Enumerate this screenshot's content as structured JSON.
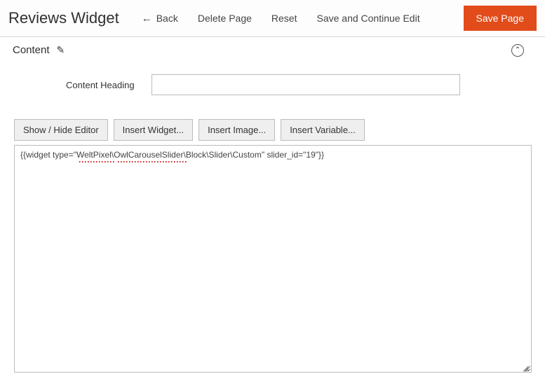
{
  "header": {
    "title": "Reviews Widget",
    "back_label": "Back",
    "delete_label": "Delete Page",
    "reset_label": "Reset",
    "save_continue_label": "Save and Continue Edit",
    "save_label": "Save Page"
  },
  "section": {
    "label": "Content"
  },
  "form": {
    "heading_label": "Content Heading",
    "heading_value": ""
  },
  "toolbar": {
    "show_hide": "Show / Hide Editor",
    "insert_widget": "Insert Widget...",
    "insert_image": "Insert Image...",
    "insert_variable": "Insert Variable..."
  },
  "editor": {
    "value": "{{widget type=\"WeltPixel\\OwlCarouselSlider\\Block\\Slider\\Custom\" slider_id=\"19\"}}"
  }
}
